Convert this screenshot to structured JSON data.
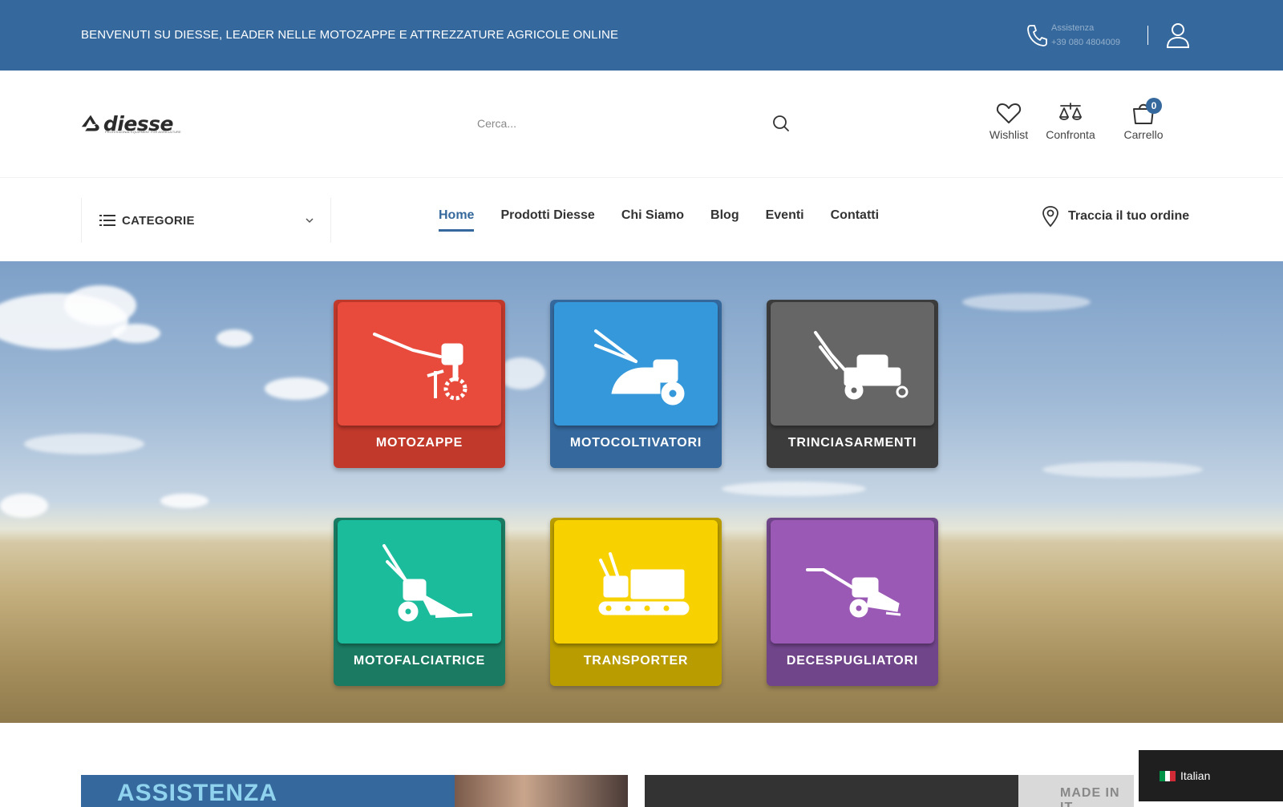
{
  "topbar": {
    "welcome": "BENVENUTI SU DIESSE, LEADER NELLE MOTOZAPPE E ATTREZZATURE AGRICOLE ONLINE",
    "support_label": "Assistenza",
    "support_phone": "+39 080 4804009",
    "phone_icon": "phone-icon",
    "user_icon": "user-icon",
    "background": "#35689c"
  },
  "header": {
    "logo_text": "diesse",
    "logo_tagline": "PROFESSIONAL EQUIPMENT FOR AGRICULTURE",
    "search_placeholder": "Cerca...",
    "search_icon": "search-icon",
    "wishlist_label": "Wishlist",
    "compare_label": "Confronta",
    "cart_label": "Carrello",
    "cart_count": "0",
    "accent": "#35689c"
  },
  "nav": {
    "categories_label": "CATEGORIE",
    "menu": [
      {
        "label": "Home",
        "active": true
      },
      {
        "label": "Prodotti Diesse"
      },
      {
        "label": "Chi Siamo"
      },
      {
        "label": "Blog"
      },
      {
        "label": "Eventi"
      },
      {
        "label": "Contatti"
      }
    ],
    "track_label": "Traccia il tuo ordine"
  },
  "hero": {
    "tiles": [
      {
        "label": "MOTOZAPPE",
        "color": "#e84a3c",
        "base": "#c0392b",
        "icon": "tiller-icon"
      },
      {
        "label": "MOTOCOLTIVATORI",
        "color": "#3498db",
        "base": "#35689c",
        "icon": "cultivator-icon"
      },
      {
        "label": "TRINCIASARMENTI",
        "color": "#666666",
        "base": "#3c3c3c",
        "icon": "mulcher-icon"
      },
      {
        "label": "MOTOFALCIATRICE",
        "color": "#1abc9c",
        "base": "#1a7a62",
        "icon": "mower-icon"
      },
      {
        "label": "TRANSPORTER",
        "color": "#f8d200",
        "base": "#b89c00",
        "icon": "transporter-icon"
      },
      {
        "label": "DECESPUGLIATORI",
        "color": "#9b59b6",
        "base": "#71458a",
        "icon": "brushcutter-icon"
      }
    ]
  },
  "bottom": {
    "left_banner_title": "ASSISTENZA",
    "right_banner_stamp": "MADE IN IT"
  },
  "language": {
    "label": "Italian",
    "flag_colors": [
      "#009246",
      "#ffffff",
      "#ce2b37"
    ]
  }
}
